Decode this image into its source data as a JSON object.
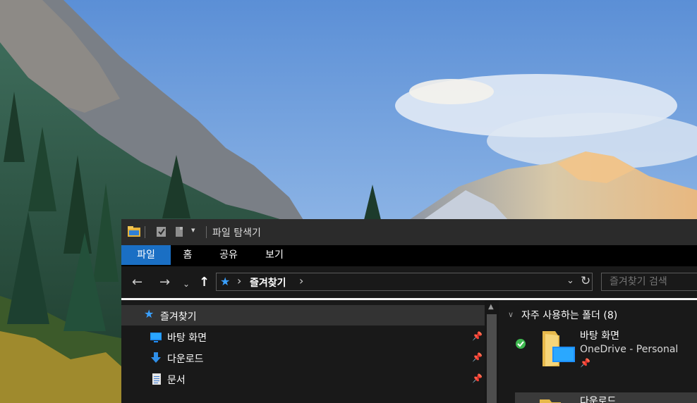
{
  "window": {
    "title": "파일 탐색기"
  },
  "ribbon": {
    "tabs": [
      {
        "label": "파일",
        "active": true
      },
      {
        "label": "홈",
        "active": false
      },
      {
        "label": "공유",
        "active": false
      },
      {
        "label": "보기",
        "active": false
      }
    ]
  },
  "address": {
    "location": "즐겨찾기",
    "search_placeholder": "즐겨찾기 검색"
  },
  "navigation": {
    "items": [
      {
        "label": "즐겨찾기",
        "icon": "star-icon",
        "selected": true,
        "pinned": false
      },
      {
        "label": "바탕 화면",
        "icon": "desktop-icon",
        "selected": false,
        "pinned": true
      },
      {
        "label": "다운로드",
        "icon": "download-icon",
        "selected": false,
        "pinned": true
      },
      {
        "label": "문서",
        "icon": "document-icon",
        "selected": false,
        "pinned": true
      }
    ]
  },
  "content": {
    "group_title": "자주 사용하는 폴더 (8)",
    "folders": [
      {
        "name": "바탕 화면",
        "subtitle": "OneDrive - Personal",
        "status": "synced",
        "pinned": true
      },
      {
        "name": "다운로드"
      }
    ]
  },
  "colors": {
    "accent": "#1a6fc4",
    "star": "#3aa0ff",
    "window_bg": "#191919",
    "titlebar": "#2b2b2b",
    "ribbon_bg": "#000000",
    "sync_ok": "#3fb950"
  }
}
